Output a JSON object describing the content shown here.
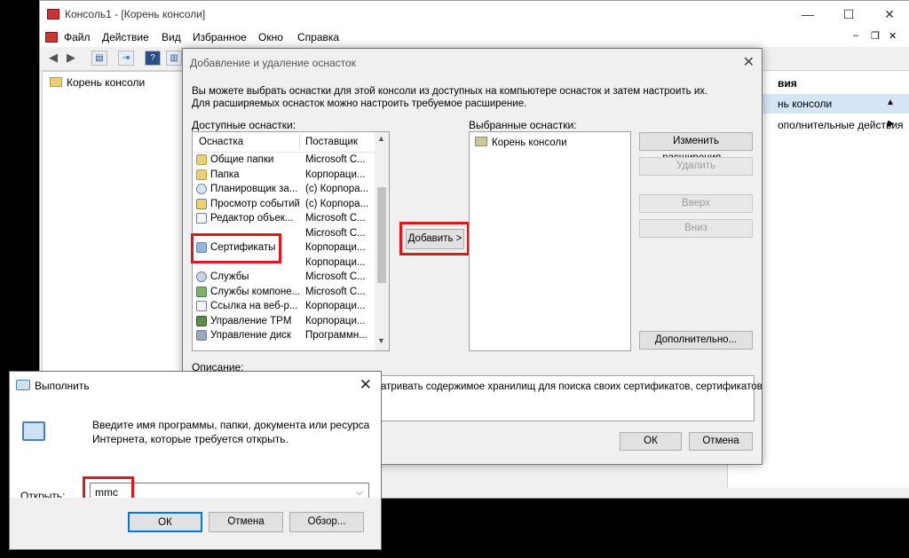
{
  "mmc": {
    "title": "Консоль1 - [Корень консоли]",
    "menu": [
      "Файл",
      "Действие",
      "Вид",
      "Избранное",
      "Окно",
      "Справка"
    ],
    "tree_root": "Корень консоли",
    "actions_header": "вия",
    "actions_selected": "нь консоли",
    "actions_more": "ополнительные действия"
  },
  "dialog": {
    "title": "Добавление и удаление оснасток",
    "intro": "Вы можете выбрать оснастки для этой консоли из доступных на компьютере оснасток и затем настроить их. Для расширяемых оснасток можно настроить требуемое расширение.",
    "available_label": "Доступные оснастки:",
    "selected_label": "Выбранные оснастки:",
    "col_snapin": "Оснастка",
    "col_vendor": "Поставщик",
    "snapins": [
      {
        "name": "Общие папки",
        "vendor": "Microsoft C..."
      },
      {
        "name": "Папка",
        "vendor": "Корпораци..."
      },
      {
        "name": "Планировщик за...",
        "vendor": "(c) Корпора..."
      },
      {
        "name": "Просмотр событий",
        "vendor": "(c) Корпора..."
      },
      {
        "name": "Редактор объек...",
        "vendor": "Microsoft C..."
      },
      {
        "name": "",
        "vendor": "Microsoft C..."
      },
      {
        "name": "Сертификаты",
        "vendor": "Корпораци..."
      },
      {
        "name": "",
        "vendor": "Корпораци..."
      },
      {
        "name": "Службы",
        "vendor": "Microsoft C..."
      },
      {
        "name": "Службы компоне...",
        "vendor": "Microsoft C..."
      },
      {
        "name": "Ссылка на веб-р...",
        "vendor": "Корпораци..."
      },
      {
        "name": "Управление TPM",
        "vendor": "Корпораци..."
      },
      {
        "name": "Управление диск",
        "vendor": "Программн..."
      }
    ],
    "selected_item": "Корень консоли",
    "add_button": "Добавить >",
    "edit_ext_button": "Изменить расширения...",
    "remove_button": "Удалить",
    "up_button": "Вверх",
    "down_button": "Вниз",
    "advanced_button": "Дополнительно...",
    "description_label": "Описание:",
    "description_text": "атривать содержимое хранилищ для поиска своих сертификатов, сертификатов",
    "ok_button": "ОК",
    "cancel_button": "Отмена"
  },
  "run": {
    "title": "Выполнить",
    "prompt": "Введите имя программы, папки, документа или ресурса Интернета, которые требуется открыть.",
    "open_label": "Открыть:",
    "input_value": "mmc",
    "ok_button": "ОК",
    "cancel_button": "Отмена",
    "browse_button": "Обзор..."
  },
  "colors": {
    "highlight": "#e0161e",
    "selection": "#d6e5f5"
  }
}
